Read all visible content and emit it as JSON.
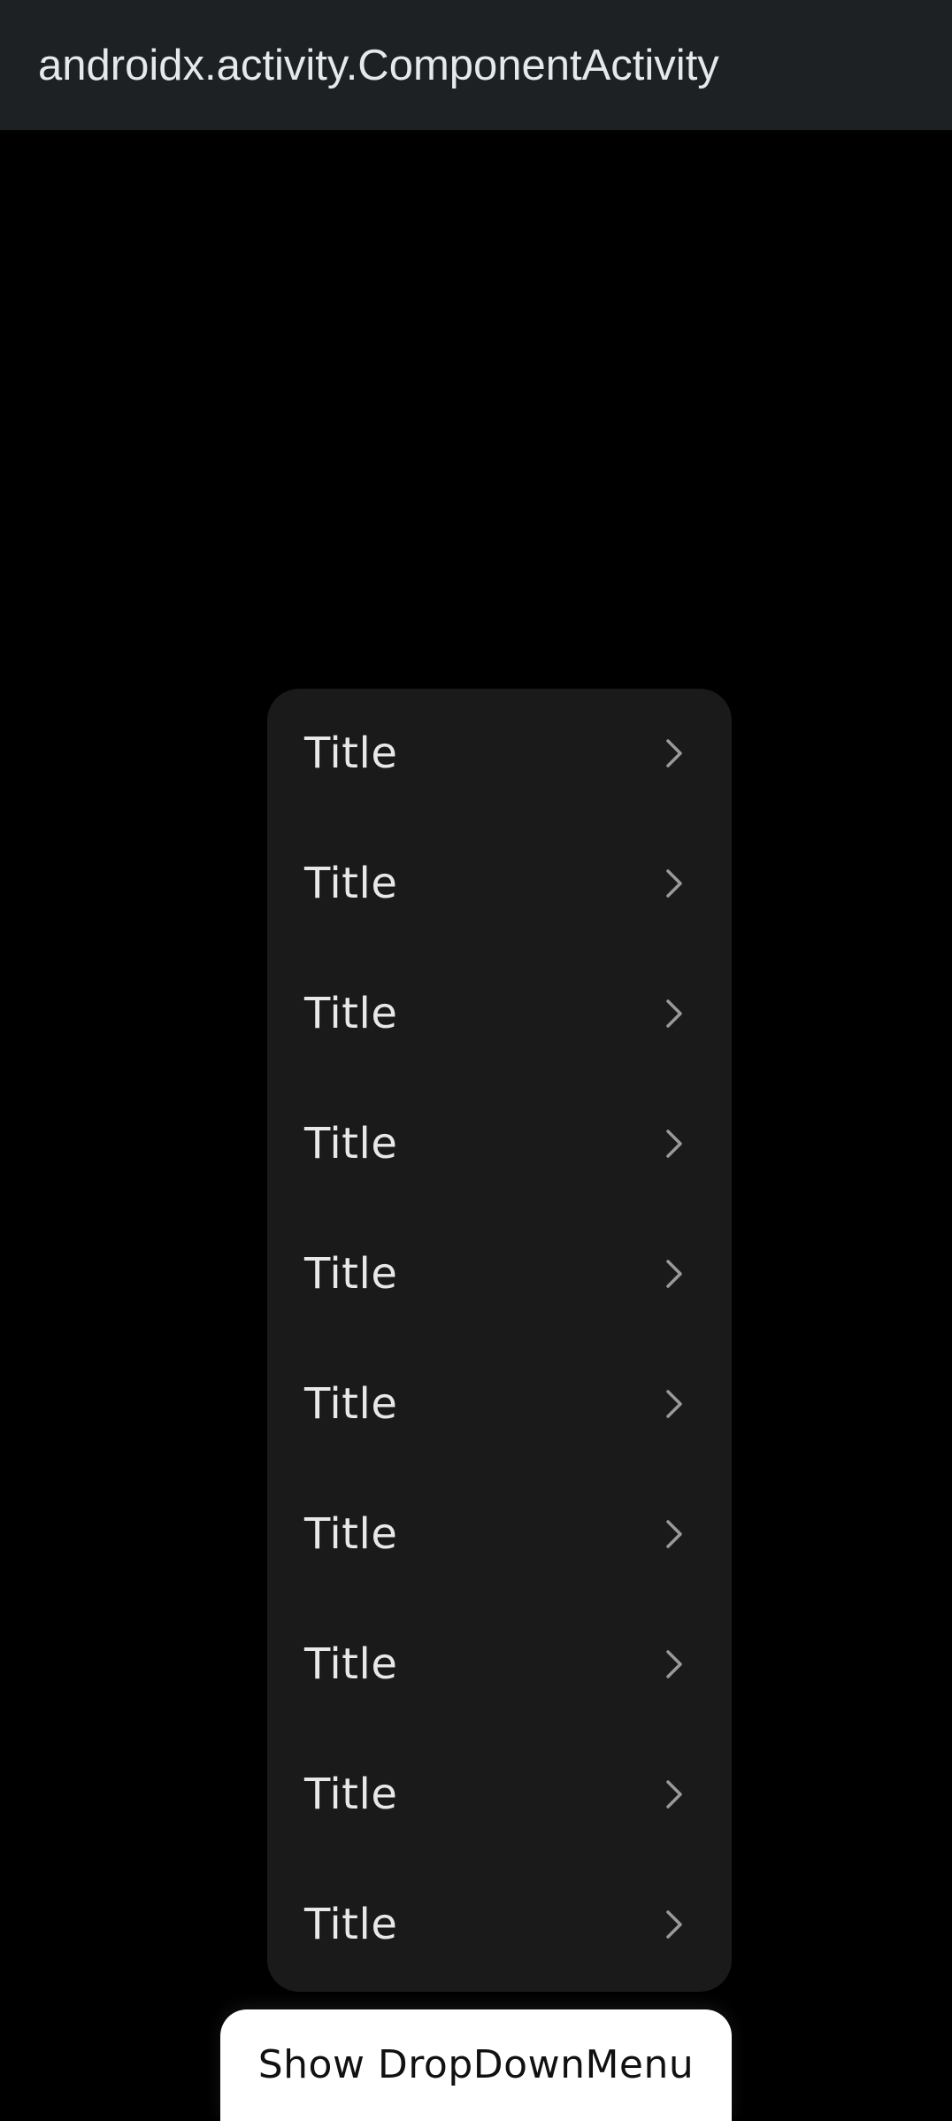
{
  "app_bar": {
    "title": "androidx.activity.ComponentActivity"
  },
  "dropdown_menu": {
    "items": [
      {
        "label": "Title",
        "icon": "chevron-right-icon"
      },
      {
        "label": "Title",
        "icon": "chevron-right-icon"
      },
      {
        "label": "Title",
        "icon": "chevron-right-icon"
      },
      {
        "label": "Title",
        "icon": "chevron-right-icon"
      },
      {
        "label": "Title",
        "icon": "chevron-right-icon"
      },
      {
        "label": "Title",
        "icon": "chevron-right-icon"
      },
      {
        "label": "Title",
        "icon": "chevron-right-icon"
      },
      {
        "label": "Title",
        "icon": "chevron-right-icon"
      },
      {
        "label": "Title",
        "icon": "chevron-right-icon"
      },
      {
        "label": "Title",
        "icon": "chevron-right-icon"
      }
    ]
  },
  "show_button": {
    "label": "Show DropDownMenu"
  },
  "colors": {
    "app_bar_bg": "#1d2124",
    "screen_bg": "#000000",
    "menu_bg": "#1a1a1a",
    "button_bg": "#ffffff"
  }
}
